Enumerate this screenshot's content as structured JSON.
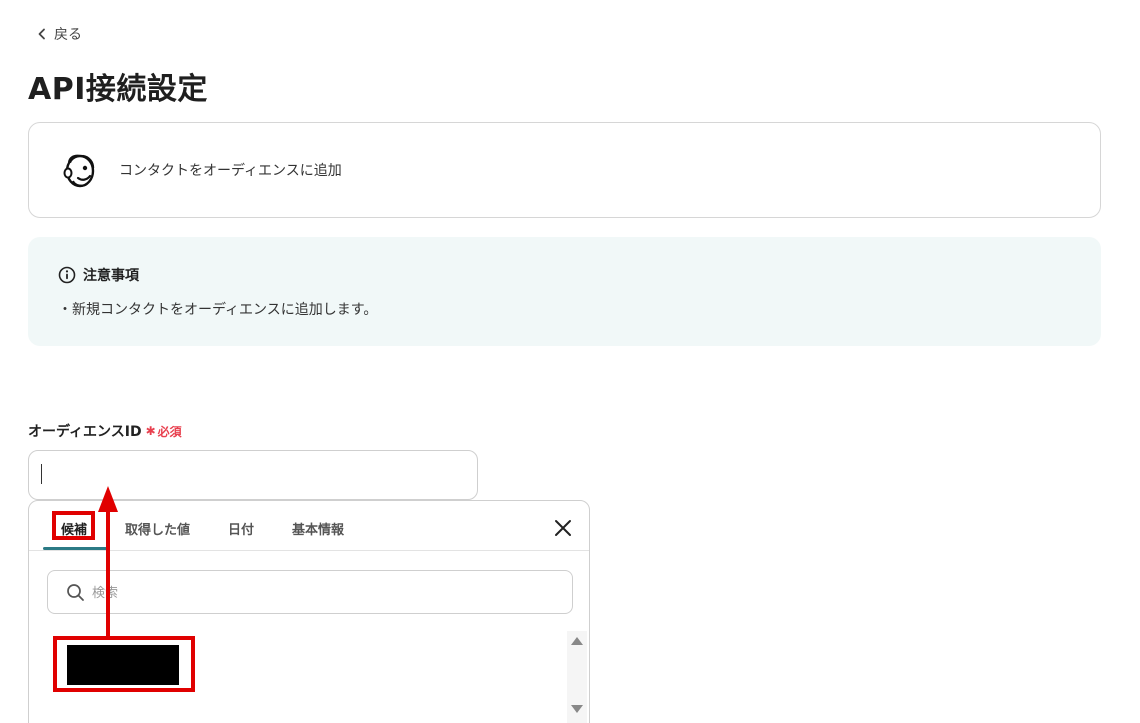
{
  "nav": {
    "back_label": "戻る"
  },
  "page": {
    "title": "API接続設定"
  },
  "app_card": {
    "action_label": "コンタクトをオーディエンスに追加",
    "logo_icon": "mailchimp-logo"
  },
  "notice": {
    "heading": "注意事項",
    "body": "・新規コンタクトをオーディエンスに追加します。"
  },
  "field": {
    "label": "オーディエンスID",
    "required_label": "必須",
    "value": ""
  },
  "picker": {
    "tabs": [
      {
        "label": "候補",
        "active": true
      },
      {
        "label": "取得した値",
        "active": false
      },
      {
        "label": "日付",
        "active": false
      },
      {
        "label": "基本情報",
        "active": false
      }
    ],
    "search_placeholder": "検索",
    "candidates": [
      "[redacted]"
    ]
  },
  "colors": {
    "accent": "#2b7a85",
    "required": "#e8404f",
    "annotation": "#e00000",
    "notice_bg": "#f1f8f8"
  }
}
